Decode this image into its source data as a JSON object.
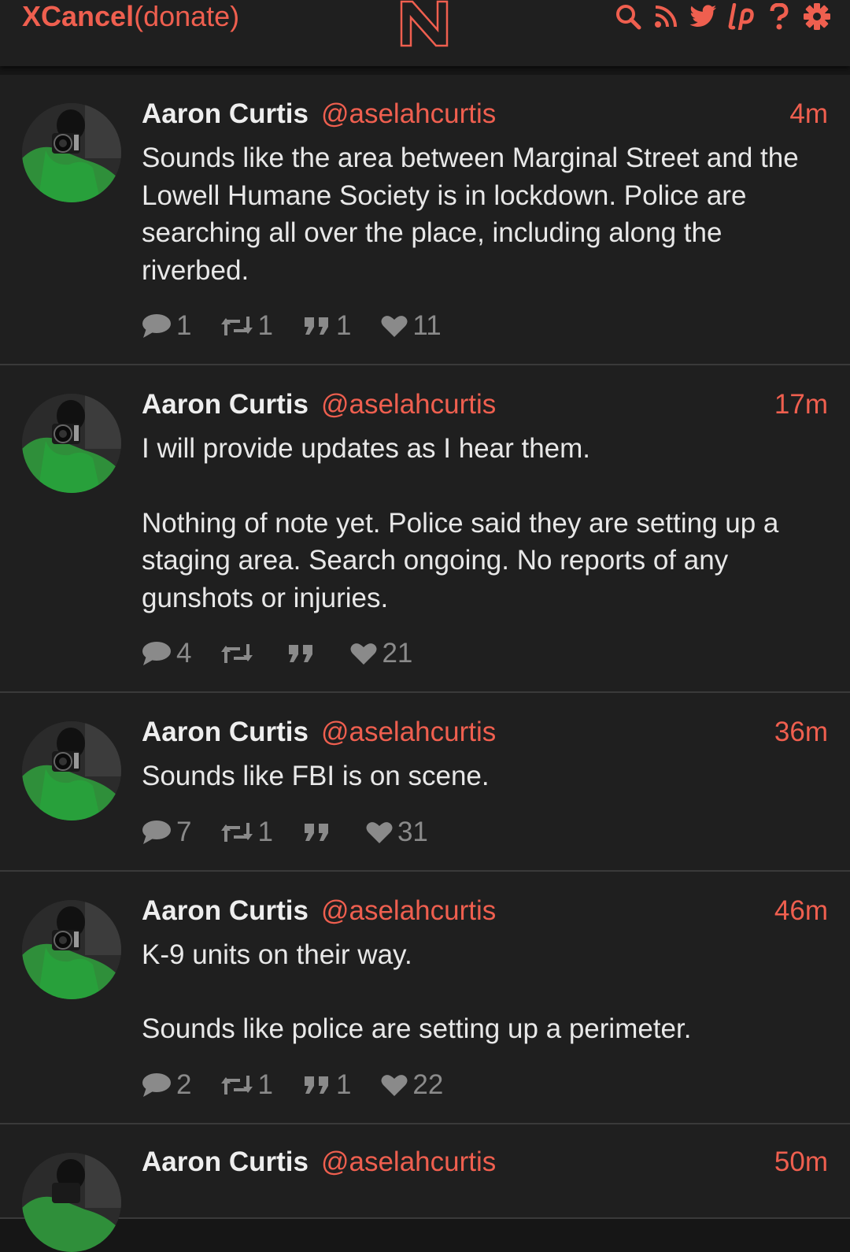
{
  "header": {
    "brand_bold": "XCancel",
    "brand_light": "(donate)",
    "logo_letter": "N",
    "icons": [
      "search-icon",
      "rss-icon",
      "twitter-bird-icon",
      "liberapay-icon",
      "help-icon",
      "gear-icon"
    ]
  },
  "colors": {
    "accent": "#ef5f4f",
    "background": "#161616",
    "card": "#1f1f1f",
    "muted": "#8a8a8a"
  },
  "tweets": [
    {
      "name": "Aaron Curtis",
      "handle": "@aselahcurtis",
      "time": "4m",
      "paragraphs": [
        "Sounds like the area between Marginal Street and the Lowell Humane Society is in lockdown. Police are searching all over the place, including along the riverbed."
      ],
      "replies": "1",
      "retweets": "1",
      "quotes": "1",
      "likes": "11"
    },
    {
      "name": "Aaron Curtis",
      "handle": "@aselahcurtis",
      "time": "17m",
      "paragraphs": [
        "I will provide updates as I hear them.",
        "Nothing of note yet. Police said they are setting up a staging area. Search ongoing. No reports of any gunshots or injuries."
      ],
      "replies": "4",
      "retweets": "",
      "quotes": "",
      "likes": "21"
    },
    {
      "name": "Aaron Curtis",
      "handle": "@aselahcurtis",
      "time": "36m",
      "paragraphs": [
        "Sounds like FBI is on scene."
      ],
      "replies": "7",
      "retweets": "1",
      "quotes": "",
      "likes": "31"
    },
    {
      "name": "Aaron Curtis",
      "handle": "@aselahcurtis",
      "time": "46m",
      "paragraphs": [
        "K-9 units on their way.",
        "Sounds like police are setting up a perimeter."
      ],
      "replies": "2",
      "retweets": "1",
      "quotes": "1",
      "likes": "22"
    },
    {
      "name": "Aaron Curtis",
      "handle": "@aselahcurtis",
      "time": "50m"
    }
  ]
}
